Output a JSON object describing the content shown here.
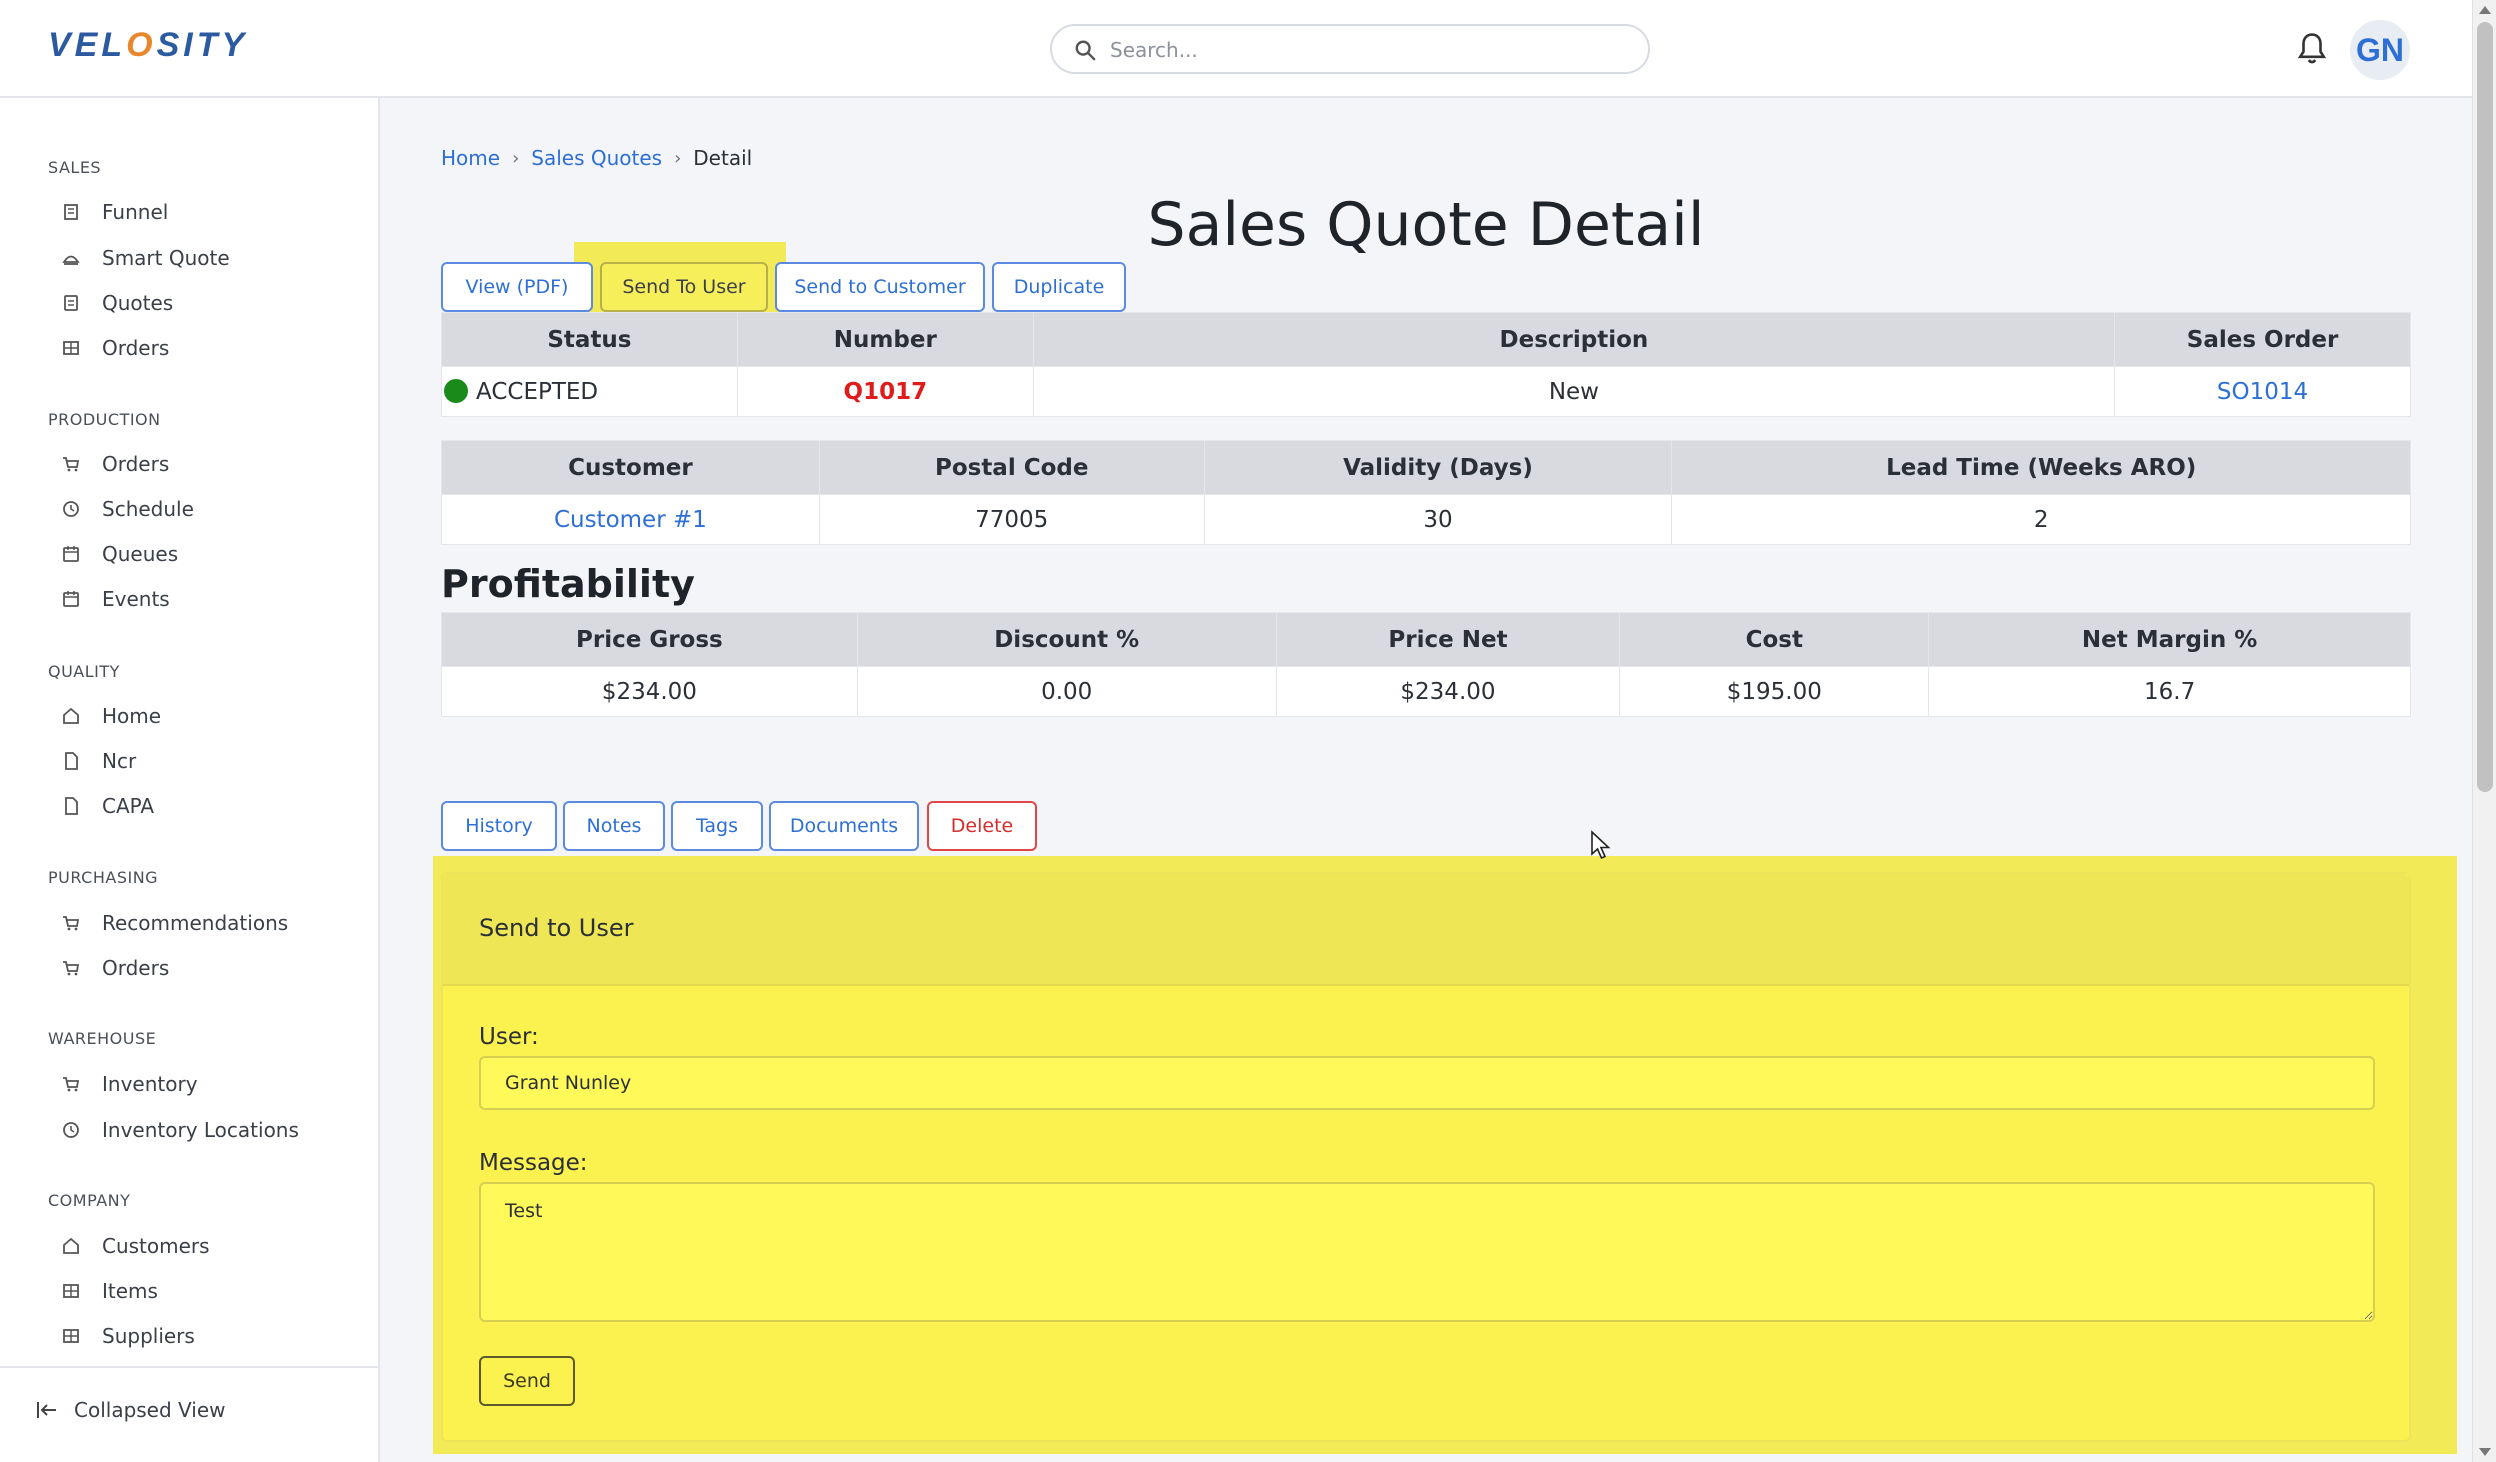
{
  "app": {
    "logo": "VELOSITY"
  },
  "header": {
    "search_placeholder": "Search...",
    "avatar_initials": "GN"
  },
  "sidebar": {
    "sections": [
      {
        "title": "SALES",
        "items": [
          {
            "label": "Funnel",
            "icon": "funnel-icon"
          },
          {
            "label": "Smart Quote",
            "icon": "smart-quote-icon"
          },
          {
            "label": "Quotes",
            "icon": "quotes-icon"
          },
          {
            "label": "Orders",
            "icon": "orders-icon"
          }
        ]
      },
      {
        "title": "PRODUCTION",
        "items": [
          {
            "label": "Orders",
            "icon": "cart-icon"
          },
          {
            "label": "Schedule",
            "icon": "clock-icon"
          },
          {
            "label": "Queues",
            "icon": "calendar-icon"
          },
          {
            "label": "Events",
            "icon": "calendar-icon"
          }
        ]
      },
      {
        "title": "QUALITY",
        "items": [
          {
            "label": "Home",
            "icon": "home-icon"
          },
          {
            "label": "Ncr",
            "icon": "document-icon"
          },
          {
            "label": "CAPA",
            "icon": "document-icon"
          }
        ]
      },
      {
        "title": "PURCHASING",
        "items": [
          {
            "label": "Recommendations",
            "icon": "cart-icon"
          },
          {
            "label": "Orders",
            "icon": "cart-icon"
          }
        ]
      },
      {
        "title": "WAREHOUSE",
        "items": [
          {
            "label": "Inventory",
            "icon": "cart-icon"
          },
          {
            "label": "Inventory Locations",
            "icon": "clock-icon"
          }
        ]
      },
      {
        "title": "COMPANY",
        "items": [
          {
            "label": "Customers",
            "icon": "home-icon"
          },
          {
            "label": "Items",
            "icon": "grid-icon"
          },
          {
            "label": "Suppliers",
            "icon": "grid-icon"
          }
        ]
      }
    ],
    "collapse_label": "Collapsed View"
  },
  "breadcrumb": {
    "home": "Home",
    "quotes": "Sales Quotes",
    "current": "Detail"
  },
  "page_title": "Sales Quote Detail",
  "actions": {
    "view_pdf": "View (PDF)",
    "send_to_user": "Send To User",
    "send_to_customer": "Send to Customer",
    "duplicate": "Duplicate"
  },
  "quote_table": {
    "headers": [
      "Status",
      "Number",
      "Description",
      "Sales Order"
    ],
    "status": "ACCEPTED",
    "status_color": "#1a8a1a",
    "number": "Q1017",
    "description": "New",
    "sales_order": "SO1014"
  },
  "customer_table": {
    "headers": [
      "Customer",
      "Postal Code",
      "Validity (Days)",
      "Lead Time (Weeks ARO)"
    ],
    "customer": "Customer #1",
    "postal_code": "77005",
    "validity": "30",
    "lead_time": "2"
  },
  "profitability": {
    "title": "Profitability",
    "headers": [
      "Price Gross",
      "Discount %",
      "Price Net",
      "Cost",
      "Net Margin %"
    ],
    "price_gross": "$234.00",
    "discount": "0.00",
    "price_net": "$234.00",
    "cost": "$195.00",
    "net_margin": "16.7"
  },
  "tabs": {
    "history": "History",
    "notes": "Notes",
    "tags": "Tags",
    "documents": "Documents",
    "delete": "Delete"
  },
  "send_to_user": {
    "title": "Send to User",
    "user_label": "User:",
    "user_value": "Grant Nunley",
    "message_label": "Message:",
    "message_value": "Test",
    "send_label": "Send"
  },
  "colors": {
    "accent": "#2e6fd6",
    "danger": "#d92c2c",
    "highlight": "#fbf14f"
  }
}
